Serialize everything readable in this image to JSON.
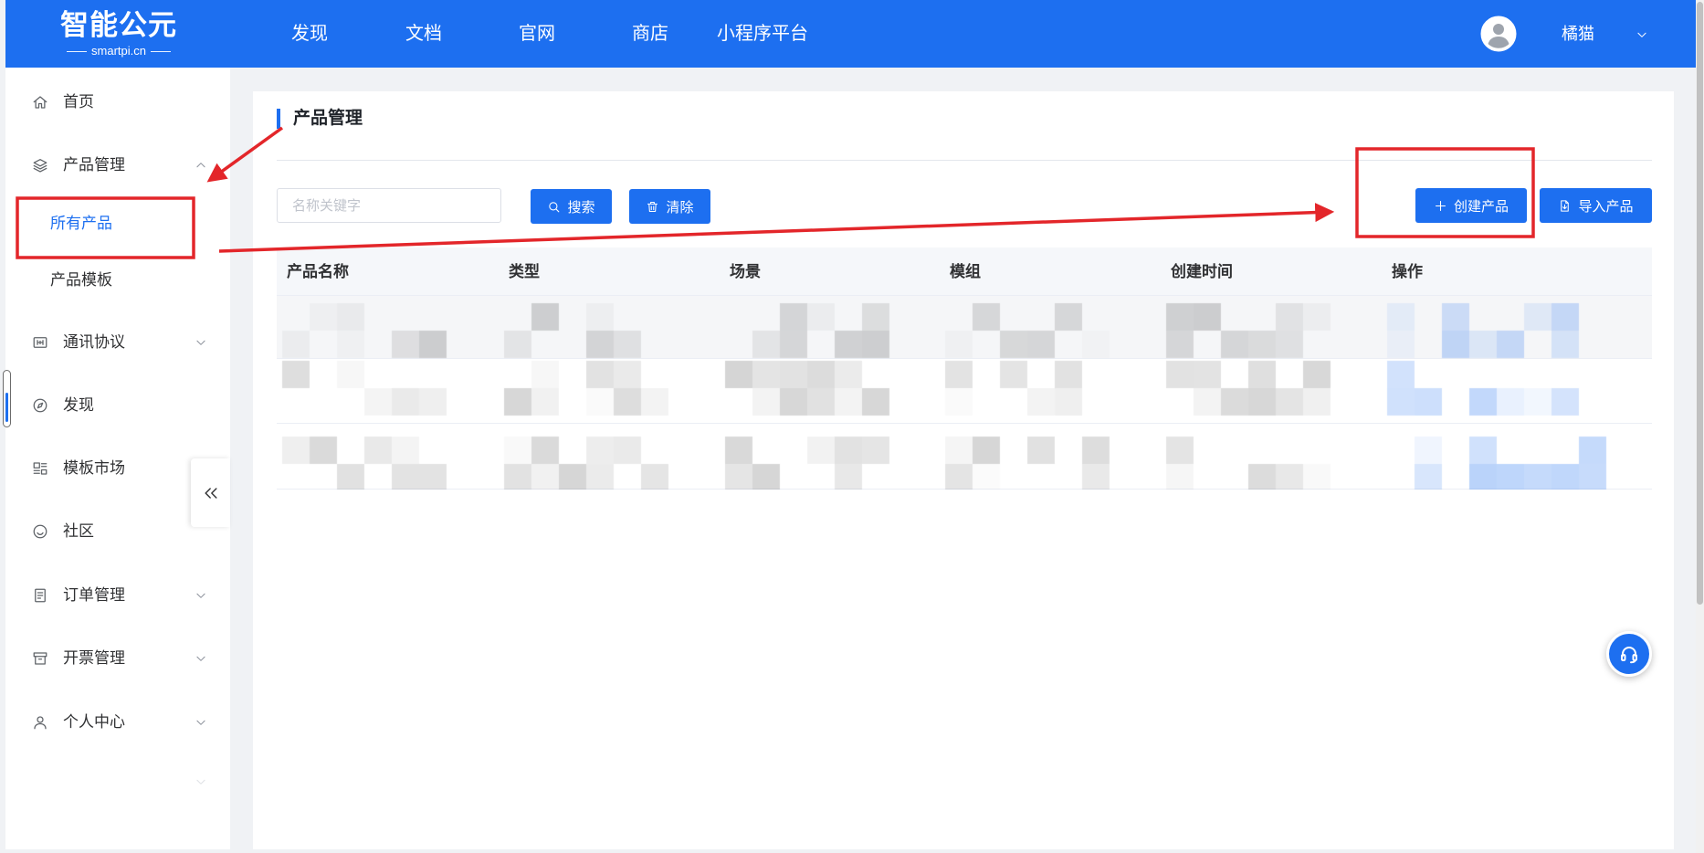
{
  "theme": {
    "primary": "#1d6ff0",
    "annotation": "#e3262a"
  },
  "header": {
    "logo_title": "智能公元",
    "logo_subtitle": "smartpi.cn",
    "nav": [
      {
        "label": "发现"
      },
      {
        "label": "文档"
      },
      {
        "label": "官网"
      },
      {
        "label": "商店"
      },
      {
        "label": "小程序平台"
      }
    ],
    "user": {
      "name": "橘猫",
      "avatar_icon": "user-avatar-icon",
      "menu_icon": "chevron-down-icon"
    }
  },
  "sidebar": {
    "items": [
      {
        "label": "首页",
        "icon": "home-icon"
      },
      {
        "label": "产品管理",
        "icon": "layers-icon",
        "expanded": true,
        "children": [
          {
            "label": "所有产品",
            "active": true
          },
          {
            "label": "产品模板"
          }
        ]
      },
      {
        "label": "通讯协议",
        "icon": "protocol-icon",
        "expandable": true
      },
      {
        "label": "发现",
        "icon": "compass-icon"
      },
      {
        "label": "模板市场",
        "icon": "template-icon"
      },
      {
        "label": "社区",
        "icon": "smile-icon"
      },
      {
        "label": "订单管理",
        "icon": "order-icon",
        "expandable": true
      },
      {
        "label": "开票管理",
        "icon": "invoice-icon",
        "expandable": true
      },
      {
        "label": "个人中心",
        "icon": "user-icon",
        "expandable": true
      }
    ],
    "collapse_icon": "double-chevron-left-icon"
  },
  "main": {
    "title": "产品管理",
    "search": {
      "placeholder": "名称关键字",
      "value": ""
    },
    "buttons": {
      "search": "搜索",
      "clear": "清除",
      "create": "创建产品",
      "import": "导入产品"
    },
    "table": {
      "columns": [
        "产品名称",
        "类型",
        "场景",
        "模组",
        "创建时间",
        "操作"
      ],
      "rows": [
        [
          "",
          "",
          "",
          "",
          "",
          ""
        ],
        [
          "",
          "",
          "",
          "",
          "",
          ""
        ],
        [
          "",
          "",
          "",
          "",
          "",
          ""
        ]
      ]
    }
  },
  "floating": {
    "support_icon": "headset-icon"
  }
}
